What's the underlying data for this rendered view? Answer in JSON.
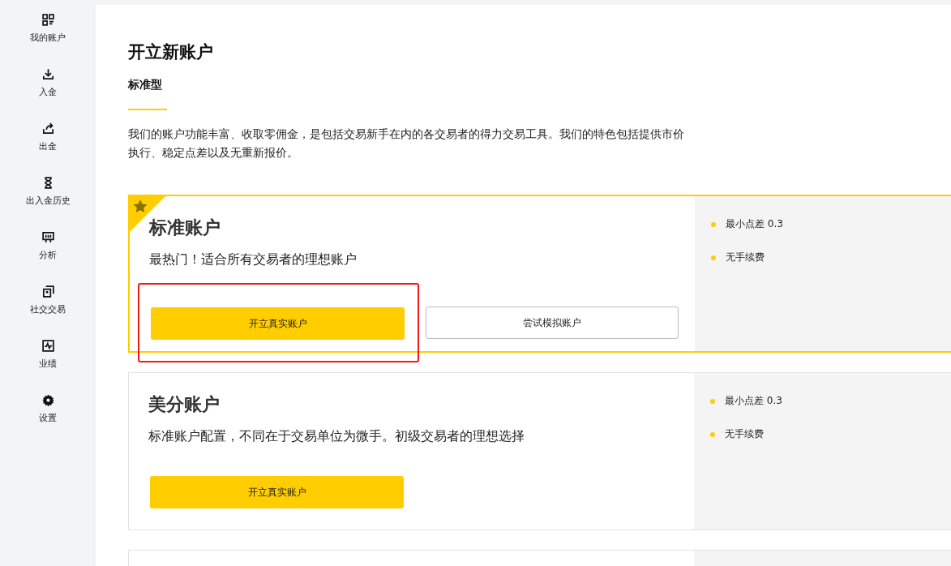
{
  "sidebar": {
    "items": [
      {
        "label": "我的账户"
      },
      {
        "label": "入金"
      },
      {
        "label": "出金"
      },
      {
        "label": "出入金历史"
      },
      {
        "label": "分析"
      },
      {
        "label": "社交交易"
      },
      {
        "label": "业绩"
      },
      {
        "label": "设置"
      }
    ]
  },
  "page": {
    "title": "开立新账户",
    "tabs": [
      {
        "label": "标准型",
        "selected": true
      }
    ],
    "description": "我们的账户功能丰富、收取零佣金，是包括交易新手在内的各交易者的得力交易工具。我们的特色包括提供市价执行、稳定点差以及无重新报价。"
  },
  "accounts": [
    {
      "name": "标准账户",
      "subtitle": "最热门！适合所有交易者的理想账户",
      "featured": true,
      "highlighted": true,
      "primary_button": "开立真实账户",
      "secondary_button": "尝试模拟账户",
      "features": [
        "最小点差 0.3",
        "无手续费"
      ]
    },
    {
      "name": "美分账户",
      "subtitle": "标准账户配置，不同在于交易单位为微手。初级交易者的理想选择",
      "featured": false,
      "highlighted": false,
      "primary_button": "开立真实账户",
      "features": [
        "最小点差 0.3",
        "无手续费"
      ]
    }
  ]
}
